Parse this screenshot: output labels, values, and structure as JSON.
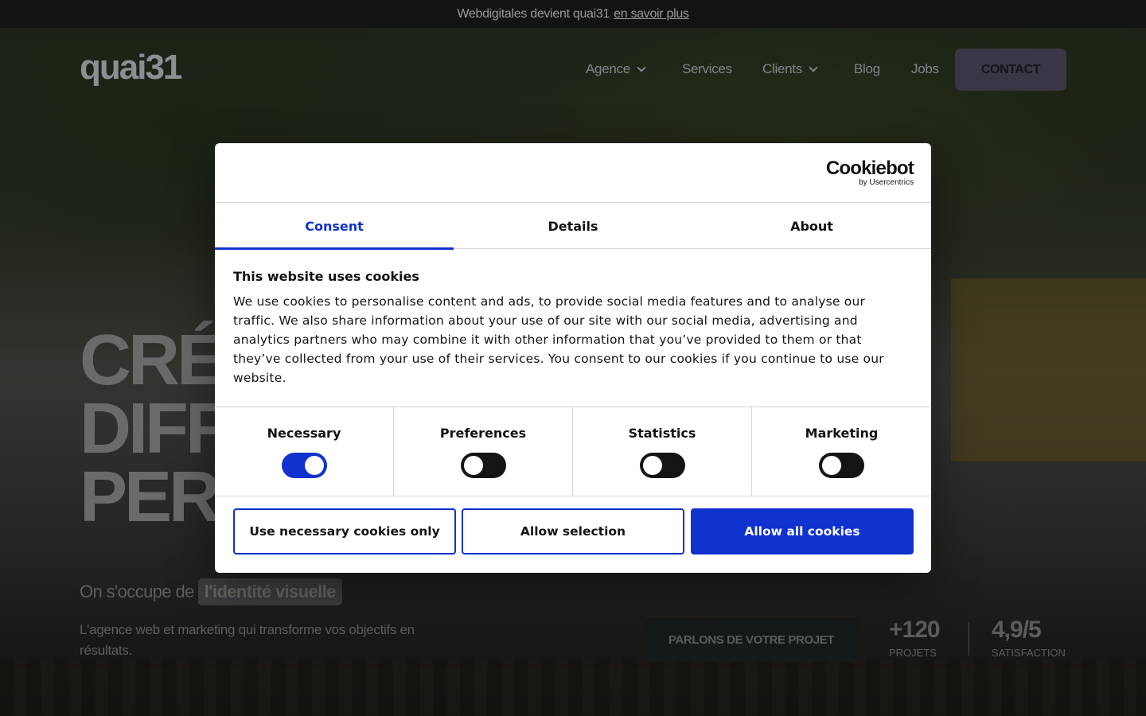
{
  "announcement": {
    "text": "Webdigitales devient quai31",
    "link": "en savoir plus"
  },
  "header": {
    "logo_text": "quai31",
    "nav": [
      {
        "label": "Agence",
        "has_dropdown": true
      },
      {
        "label": "Services",
        "has_dropdown": false
      },
      {
        "label": "Clients",
        "has_dropdown": true
      },
      {
        "label": "Blog",
        "has_dropdown": false
      },
      {
        "label": "Jobs",
        "has_dropdown": false
      }
    ],
    "contact_label": "CONTACT"
  },
  "hero": {
    "headline_lines": [
      "CRÉ",
      "DIFF",
      "PER"
    ],
    "subline_prefix": "On s'occupe de",
    "subline_highlight": "l'identité visuelle",
    "tagline": "L'agence web et marketing qui transforme vos objectifs en résultats.",
    "cta_label": "PARLONS DE VOTRE PROJET",
    "stats": [
      {
        "value": "+120",
        "label": "PROJETS"
      },
      {
        "value": "4,9/5",
        "label": "SATISFACTION"
      }
    ]
  },
  "cookie_dialog": {
    "brand_name": "Cookiebot",
    "brand_by": "by Usercentrics",
    "tabs": [
      "Consent",
      "Details",
      "About"
    ],
    "active_tab": "Consent",
    "title": "This website uses cookies",
    "body": "We use cookies to personalise content and ads, to provide social media features and to analyse our traffic. We also share information about your use of our site with our social media, advertising and analytics partners who may combine it with other information that you’ve provided to them or that they’ve collected from your use of their services. You consent to our cookies if you continue to use our website.",
    "categories": [
      {
        "label": "Necessary",
        "enabled": true
      },
      {
        "label": "Preferences",
        "enabled": false
      },
      {
        "label": "Statistics",
        "enabled": false
      },
      {
        "label": "Marketing",
        "enabled": false
      }
    ],
    "buttons": {
      "necessary_only": "Use necessary cookies only",
      "allow_selection": "Allow selection",
      "allow_all": "Allow all cookies"
    }
  },
  "colors": {
    "accent": "#1032cf",
    "toggle_off": "#141414",
    "overlay": "#000000"
  },
  "icons": [
    "chevron-down-icon"
  ]
}
